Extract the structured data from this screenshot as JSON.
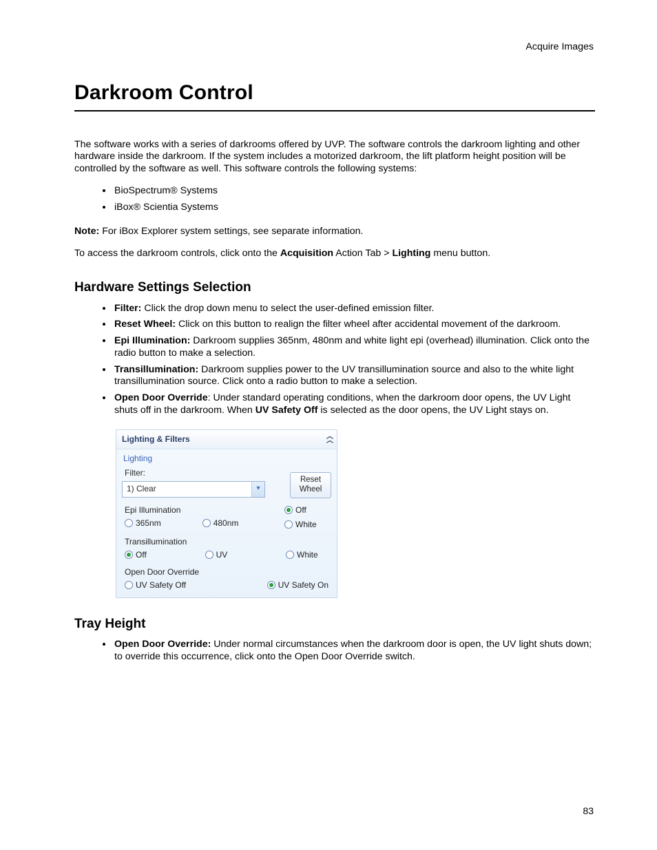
{
  "running_header": "Acquire Images",
  "page_number": "83",
  "title": "Darkroom Control",
  "intro": "The software works with a series of darkrooms offered by UVP. The software controls the darkroom lighting and other hardware inside the darkroom. If the system includes a motorized darkroom, the lift platform height position will be controlled by the software as well. This software controls the following systems:",
  "systems": [
    "BioSpectrum® Systems",
    "iBox® Scientia Systems"
  ],
  "note_label": "Note:",
  "note_text": " For iBox Explorer system settings, see separate information.",
  "access_pre": "To access the darkroom controls, click onto the ",
  "access_bold1": "Acquisition",
  "access_mid": " Action Tab > ",
  "access_bold2": "Lighting",
  "access_post": " menu button.",
  "hw_heading": "Hardware Settings Selection",
  "hw_items": [
    {
      "label": "Filter:",
      "text": " Click the drop down menu to select the user-defined emission filter."
    },
    {
      "label": "Reset Wheel:",
      "text": " Click on this button to realign the filter wheel after accidental movement of the darkroom."
    },
    {
      "label": "Epi Illumination:",
      "text": " Darkroom supplies 365nm, 480nm and white light epi (overhead) illumination. Click onto the radio button to make a selection."
    },
    {
      "label": "Transillumination:",
      "text": " Darkroom supplies power to the UV transillumination source and also to the white light transillumination source. Click onto a radio button to make a selection."
    }
  ],
  "hw_open_door": {
    "label": "Open Door Override",
    "pre": ": Under standard operating conditions, when the darkroom door opens, the UV Light shuts off in the darkroom.  When ",
    "bold": "UV Safety Off",
    "post": " is selected as the door opens, the UV Light stays on."
  },
  "panel": {
    "title": "Lighting & Filters",
    "group": "Lighting",
    "filter_label": "Filter:",
    "filter_value": "1) Clear",
    "reset_label": "Reset\nWheel",
    "epi_label": "Epi Illumination",
    "epi": {
      "off": "Off",
      "a": "365nm",
      "b": "480nm",
      "white": "White"
    },
    "trans_label": "Transillumination",
    "trans": {
      "off": "Off",
      "uv": "UV",
      "white": "White"
    },
    "override_label": "Open Door Override",
    "override": {
      "off": "UV Safety Off",
      "on": "UV Safety On"
    }
  },
  "tray_heading": "Tray Height",
  "tray_item": {
    "label": "Open Door Override:",
    "text": " Under normal circumstances when the darkroom door is open, the UV light shuts down; to override this occurrence, click onto the Open Door Override switch."
  }
}
